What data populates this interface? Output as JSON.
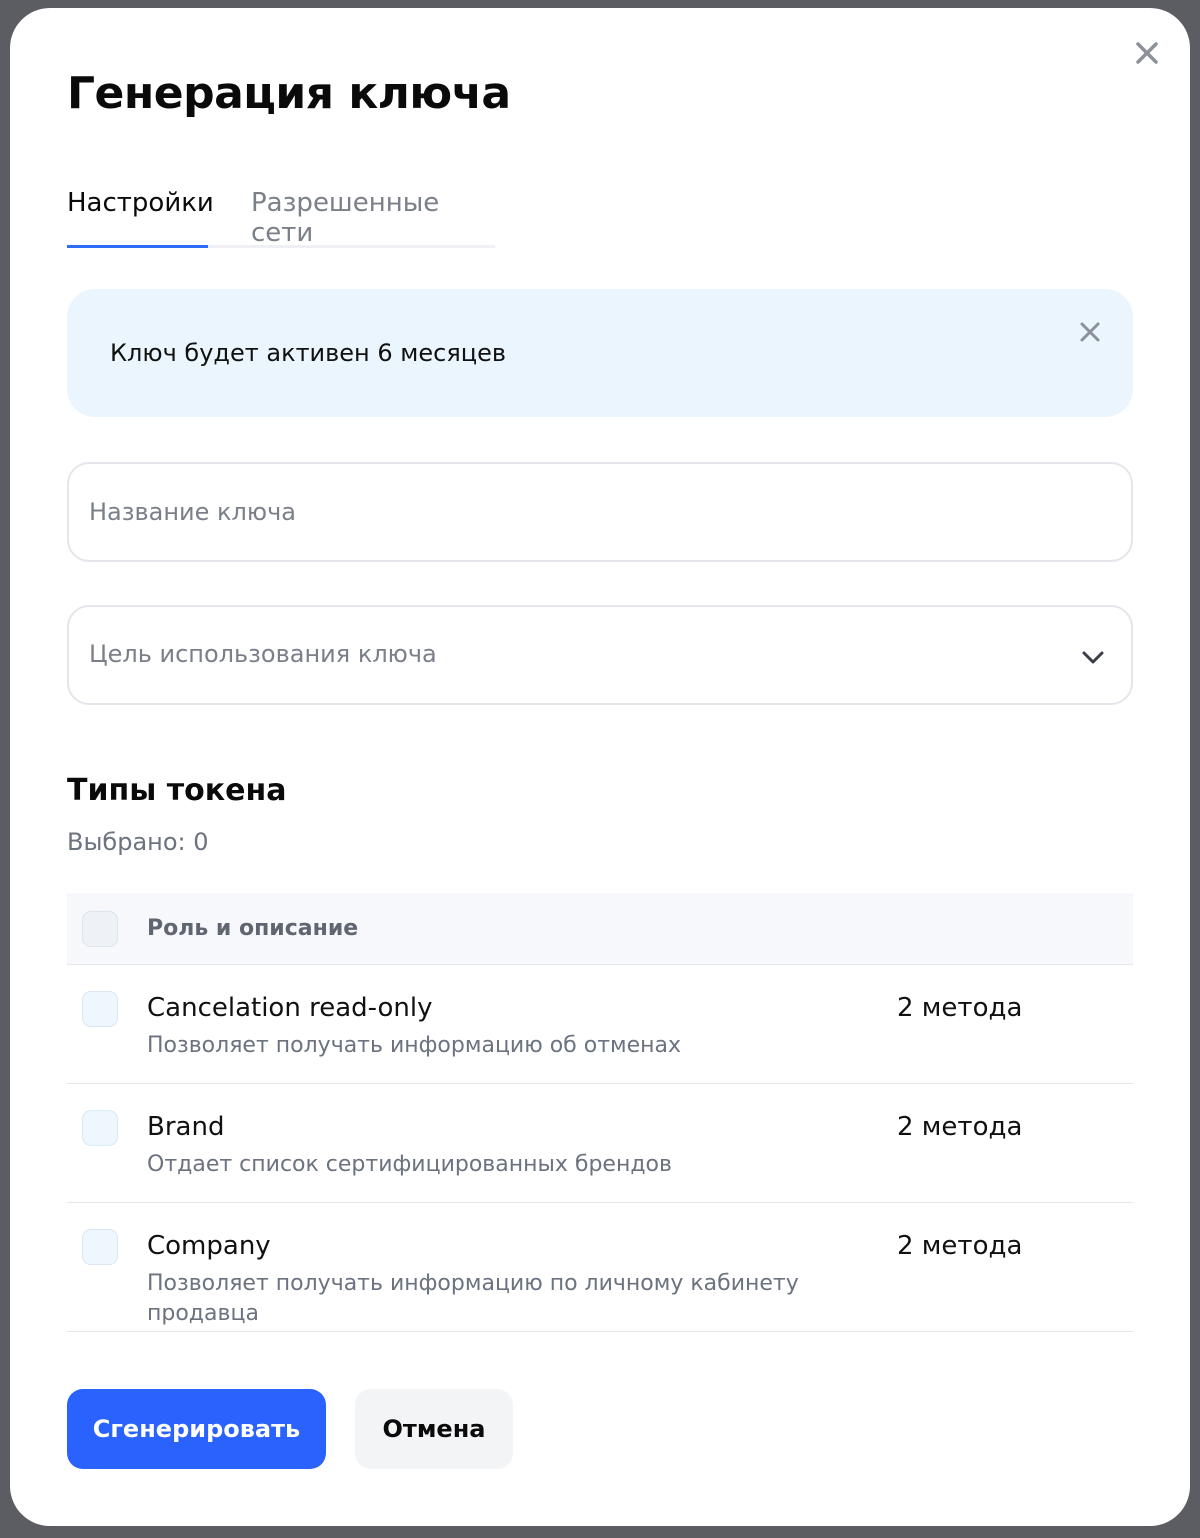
{
  "modal": {
    "title": "Генерация ключа",
    "close_icon": "close-icon"
  },
  "tabs": [
    {
      "label": "Настройки",
      "active": true
    },
    {
      "label": "Разрешенные сети",
      "active": false
    }
  ],
  "info_banner": {
    "text": "Ключ будет активен 6 месяцев",
    "close_icon": "close-icon"
  },
  "form": {
    "key_name_placeholder": "Название ключа",
    "key_name_value": "",
    "purpose_placeholder": "Цель использования ключа",
    "purpose_icon": "chevron-down-icon"
  },
  "token_types": {
    "title": "Типы токена",
    "selected_text": "Выбрано: 0",
    "header": "Роль и описание",
    "rows": [
      {
        "name": "Cancelation read-only",
        "description": "Позволяет получать информацию об отменах",
        "methods": "2 метода",
        "checked": false
      },
      {
        "name": "Brand",
        "description": "Отдает список сертифицированных брендов",
        "methods": "2 метода",
        "checked": false
      },
      {
        "name": "Company",
        "description": "Позволяет получать информацию по личному кабинету продавца",
        "methods": "2 метода",
        "checked": false
      }
    ]
  },
  "actions": {
    "generate_label": "Сгенерировать",
    "cancel_label": "Отмена"
  },
  "colors": {
    "accent": "#2a62fe",
    "info_bg": "#eaf5fd",
    "tab_underline": "#2e6bff"
  }
}
